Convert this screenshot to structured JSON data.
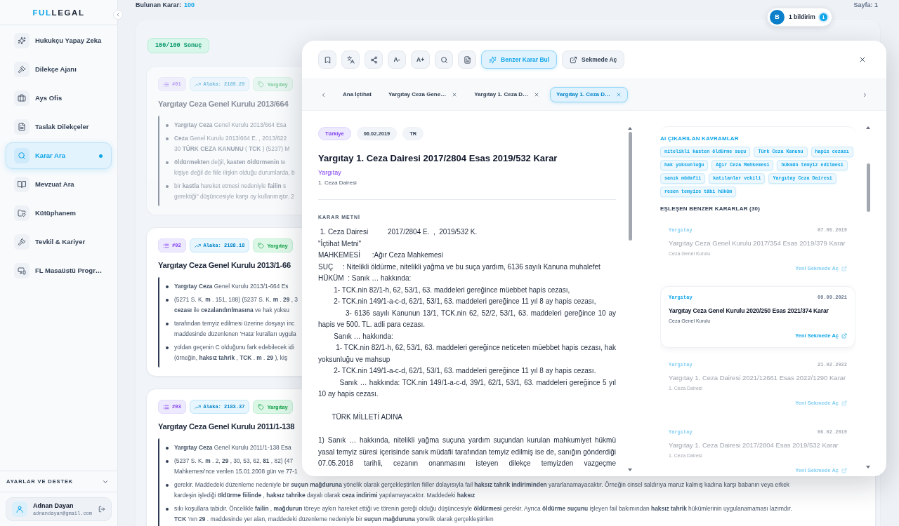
{
  "sidebar": {
    "logo_accent": "FUL",
    "logo_rest": "LEGAL",
    "items": [
      {
        "label": "Hukukçu Yapay Zeka",
        "selected": false
      },
      {
        "label": "Dilekçe Ajanı",
        "selected": false
      },
      {
        "label": "Ays Ofis",
        "selected": false
      },
      {
        "label": "Taslak Dilekçeler",
        "selected": false
      },
      {
        "label": "Karar Ara",
        "selected": true
      },
      {
        "label": "Mevzuat Ara",
        "selected": false
      },
      {
        "label": "Kütüphanem",
        "selected": false
      },
      {
        "label": "Tevkil & Kariyer",
        "selected": false
      },
      {
        "label": "FL Masaüstü Progr…",
        "selected": false
      }
    ],
    "settings": {
      "label": "AYARLAR VE DESTEK",
      "expanded": false
    },
    "user": {
      "name": "Adnan Dayan",
      "email": "adnandayan@gmail.com"
    }
  },
  "topbar": {
    "found_label": "Bulunan Karar:",
    "found_count": "100",
    "notification": {
      "avatar": "B",
      "label": "1 bildirim",
      "count": "1"
    },
    "page": "Sayfa: **1**"
  },
  "results": {
    "summary": "100/100 Sonuç",
    "cards": [
      {
        "number": "#01",
        "score": "Alaka: 2189.29",
        "source": "Yargıtay",
        "dimmed": true,
        "title": "Yargıtay Ceza Genel Kurulu 2013/664",
        "snippets": [
          [
            "**Yargıtay** **Ceza** Genel Kurulu 2013/664 Esa"
          ],
          [
            "**Ceza** Genel Kurulu 2013/664 E. , 2013/622",
            "30 **TÜRK** **CEZA** **KANUNU** ( **TCK** ) (5237) M"
          ],
          [
            "**öldürmekten** değil, **kasten** **öldürmenin** te",
            "kişiye değil de fiile ilişkin olduğu durumlarda, b"
          ],
          [
            "bir **kastla** hareket etmesi nedeniyle **failin** s",
            "gerektiği\" düşüncesiyle karşı oy kullanmıştır. 2"
          ]
        ]
      },
      {
        "number": "#02",
        "score": "Alaka: 2188.18",
        "source": "Yargıtay",
        "dimmed": false,
        "title": "Yargıtay Ceza Genel Kurulu 2013/1-66",
        "snippets": [
          [
            "**Yargıtay** **Ceza** Genel Kurulu 2013/1-664 Es"
          ],
          [
            "(5271 S. K. **m** . 151, 188) (5237 S. K. **m** . **29** , 3",
            "**cezası** ile **cezalandırılmasına** ve hak yoksu"
          ],
          [
            "tarafından temyiz edilmesi üzerine dosyayı inc",
            "maddesinde düzenlenen 'Hata' kuralları uygula"
          ],
          [
            "yoldan geçenin C olduğunu fark edebilecek idi",
            "(örneğin, **haksız** **tahrik** , **TCK** . **m** . **29** ), kiş"
          ]
        ]
      },
      {
        "number": "#03",
        "score": "Alaka: 2183.37",
        "source": "Yargıtay",
        "dimmed": false,
        "title": "Yargıtay Ceza Genel Kurulu 2011/1-138",
        "snippets": [
          [
            "**Yargıtay** **Ceza** Genel Kurulu 2011/1-138 Esa"
          ],
          [
            "(5237 S. K. **m** . 2, **29** , 30, 53, 62, **81** , 82) (47",
            "Mahkemesi'nce verilen 15.01.2008 gün ve 77-1"
          ],
          [
            "gerekir. Maddedeki düzenleme nedeniyle bir **suçun** **mağduruna** yönelik olarak gerçekleştirilen fiiller dolayısıyla fail **haksız** **tahrik** **indiriminden** yararlanamayacaktır. Örneğin cinsel saldırıya maruz kalmış kadına karşı babanın veya erkek",
            "kardeşin işlediği **öldürme** **fiilinde** , **haksız** **tahrike** dayalı olarak **ceza** **indirimi** yapılamayacaktır. Maddedeki **haksız**"
          ],
          [
            "sıkı koşullara tabidir. Öncelikle **failin** , **mağdurun** töreye aykırı hareket ettiği ve törenin gereği olduğu düşüncesiyle **öldürmesi** gerekir. Ayrıca **öldürme** **suçunu** işleyen fail bakımından **haksız** **tahrik** hükümlerinin uygulanamaması lazımdır.",
            "**TCK** 'nın **29** . maddesinde yer alan, maddedeki düzenleme nedeniyle bir **suçun** **mağduruna** yönelik olarak gerçekleştirilen"
          ]
        ]
      }
    ]
  },
  "viewer": {
    "toolbar": {
      "font_buttons": [
        "A-",
        "A+"
      ],
      "actions": [
        {
          "kind": "similar",
          "label": "Benzer Karar Bul",
          "active": true
        },
        {
          "kind": "open_tab",
          "label": "Sekmede Aç",
          "active": false
        }
      ]
    },
    "tabs": [
      {
        "label": "Ana İçtihat",
        "closable": false,
        "selected": false
      },
      {
        "label": "Yargıtay Ceza Gene…",
        "closable": true,
        "selected": false
      },
      {
        "label": "Yargıtay 1. Ceza D…",
        "closable": true,
        "selected": false
      },
      {
        "label": "Yargıtay 1. Ceza D…",
        "closable": true,
        "selected": true
      }
    ],
    "document": {
      "meta": [
        {
          "kind": "country",
          "label": "Türkiye"
        },
        {
          "kind": "date",
          "label": "06.02.2019"
        },
        {
          "kind": "language",
          "label": "TR"
        }
      ],
      "title": "Yargıtay 1. Ceza Dairesi 2017/2804 Esas 2019/532 Karar",
      "court": "Yargıtay",
      "chamber": "1. Ceza Dairesi",
      "section_label": "KARAR METNİ",
      "paragraphs": [
        {
          "kind": "line",
          "text": " 1. Ceza Dairesi          2017/2804 E.  ,  2019/532 K."
        },
        {
          "kind": "line",
          "text": "\"İçtihat Metni\""
        },
        {
          "kind": "line",
          "text": "MAHKEMESİ      :Ağır Ceza Mahkemesi"
        },
        {
          "kind": "line",
          "text": "SUÇ     : Nitelikli öldürme, nitelikli yağma ve bu suça yardım, 6136 sayılı Kanuna muhalefet"
        },
        {
          "kind": "line",
          "text": "HÜKÜM  : Sanık … hakkında:"
        },
        {
          "kind": "line",
          "text": "        1- TCK.nin 82/1-h, 62, 53/1, 63. maddeleri gereğince müebbet hapis cezası,"
        },
        {
          "kind": "line",
          "text": "        2- TCK.nin 149/1-a-c-d, 62/1, 53/1, 63. maddeleri gereğince 11 yıl 8 ay hapis cezası,"
        },
        {
          "kind": "line",
          "text": "          3- 6136 sayılı Kanunun 13/1, TCK.nin 62, 52/2, 53/1, 63. maddeleri gereğince 10 ay hapis ve 500. TL. adli para cezası."
        },
        {
          "kind": "line",
          "text": "        Sanık … hakkında:"
        },
        {
          "kind": "line",
          "text": "         1- TCK.nin 82/1-h, 62, 53/1, 63. maddeleri gereğince neticeten müebbet hapis cezası, hak yoksunluğu ve mahsup"
        },
        {
          "kind": "line",
          "text": "        2- TCK.nin 149/1-a-c-d, 62/1, 53/1, 63. maddeleri gereğince 11 yıl 8 ay hapis cezası."
        },
        {
          "kind": "line",
          "text": "         Sanık … hakkında: TCK.nin 149/1-a-c-d, 39/1, 62/1, 53/1, 63. maddeleri gereğince 5 yıl 10 ay hapis cezası."
        },
        {
          "kind": "heading",
          "text": "       TÜRK MİLLETİ ADINA"
        },
        {
          "kind": "paragraph",
          "text": "1) Sanık … hakkında, nitelikli yağma suçuna yardım suçundan kurulan mahkumiyet hükmü yasal temyiz süresi içerisinde sanık müdafii tarafından temyiz edilmiş ise de, sanığın gönderdiği 07.05.2018 tarihli, cezanın onanmasını isteyen dilekçe temyizden vazgeçme"
        }
      ]
    },
    "side": {
      "concepts_label": "AI ÇIKARILAN KAVRAMLAR",
      "concepts": [
        "nitelikli kasten öldürme suçu",
        "Türk Ceza Kanunu",
        "hapis cezası",
        "hak yoksunluğu",
        "Ağır Ceza Mahkemesi",
        "hükmün temyiz edilmesi",
        "sanık müdafii",
        "katılanlar vekili",
        "Yargıtay Ceza Dairesi",
        "resen temyize tâbi hüküm"
      ],
      "similar_label": "EŞLEŞEN BENZER KARARLAR (30)",
      "similar": [
        {
          "court": "Yargıtay",
          "date": "07.05.2019",
          "title": "Yargıtay Ceza Genel Kurulu 2017/354 Esas 2019/379 Karar",
          "chamber": "Ceza Genel Kurulu",
          "link": "Yeni Sekmede Aç",
          "selected": false
        },
        {
          "court": "Yargıtay",
          "date": "09.09.2021",
          "title": "Yargıtay Ceza Genel Kurulu 2020/250 Esas 2021/374 Karar",
          "chamber": "Ceza Genel Kurulu",
          "link": "Yeni Sekmede Aç",
          "selected": true
        },
        {
          "court": "Yargıtay",
          "date": "21.02.2022",
          "title": "Yargıtay 1. Ceza Dairesi 2021/12661 Esas 2022/1290 Karar",
          "chamber": "1. Ceza Dairesi",
          "link": "Yeni Sekmede Aç",
          "selected": false
        },
        {
          "court": "Yargıtay",
          "date": "06.02.2019",
          "title": "Yargıtay 1. Ceza Dairesi 2017/2804 Esas 2019/532 Karar",
          "chamber": "1. Ceza Dairesi",
          "link": "Yeni Sekmede Aç",
          "selected": false
        }
      ]
    }
  }
}
